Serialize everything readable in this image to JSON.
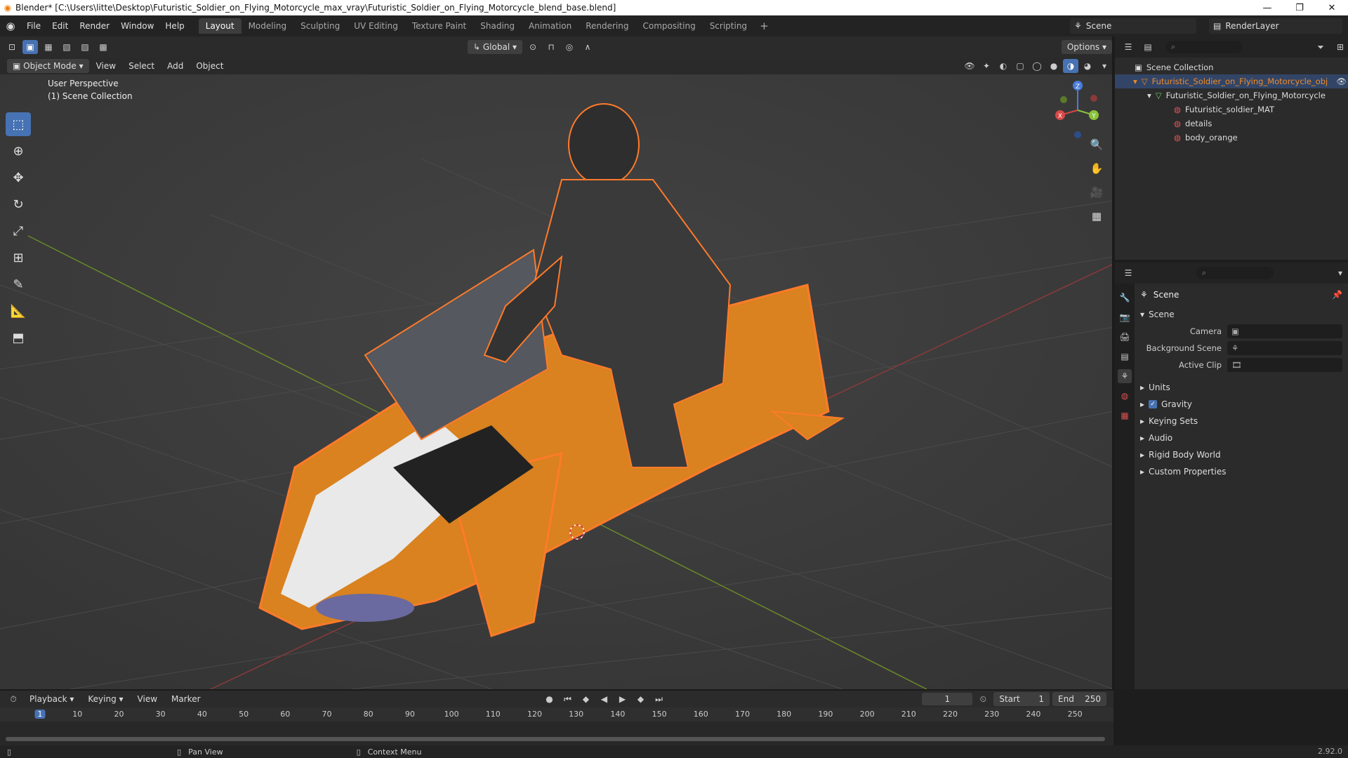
{
  "window": {
    "title": "Blender* [C:\\Users\\litte\\Desktop\\Futuristic_Soldier_on_Flying_Motorcycle_max_vray\\Futuristic_Soldier_on_Flying_Motorcycle_blend_base.blend]"
  },
  "menu": [
    "File",
    "Edit",
    "Render",
    "Window",
    "Help"
  ],
  "workspaces": [
    "Layout",
    "Modeling",
    "Sculpting",
    "UV Editing",
    "Texture Paint",
    "Shading",
    "Animation",
    "Rendering",
    "Compositing",
    "Scripting"
  ],
  "active_workspace": "Layout",
  "scene_selector": "Scene",
  "renderlayer_selector": "RenderLayer",
  "viewport": {
    "orientation": "Global",
    "options_label": "Options",
    "mode": "Object Mode",
    "menus": [
      "View",
      "Select",
      "Add",
      "Object"
    ],
    "info_line1": "User Perspective",
    "info_line2": "(1) Scene Collection",
    "axes": {
      "x": "X",
      "y": "Y",
      "z": "Z"
    }
  },
  "outliner": {
    "rows": [
      "Scene Collection",
      "Futuristic_Soldier_on_Flying_Motorcycle_obj",
      "Futuristic_Soldier_on_Flying_Motorcycle",
      "Futuristic_soldier_MAT",
      "details",
      "body_orange"
    ]
  },
  "properties": {
    "title": "Scene",
    "section": "Scene",
    "camera_label": "Camera",
    "background_label": "Background Scene",
    "clip_label": "Active Clip",
    "panels": [
      "Units",
      "Gravity",
      "Keying Sets",
      "Audio",
      "Rigid Body World",
      "Custom Properties"
    ]
  },
  "timeline": {
    "menus": [
      "Playback",
      "Keying",
      "View",
      "Marker"
    ],
    "current_frame": "1",
    "start_label": "Start",
    "start": "1",
    "end_label": "End",
    "end": "250",
    "ticks": [
      "1",
      "10",
      "20",
      "30",
      "40",
      "50",
      "60",
      "70",
      "80",
      "90",
      "100",
      "110",
      "120",
      "130",
      "140",
      "150",
      "160",
      "170",
      "180",
      "190",
      "200",
      "210",
      "220",
      "230",
      "240",
      "250"
    ]
  },
  "status": {
    "pan": "Pan View",
    "context": "Context Menu",
    "version": "2.92.0"
  }
}
